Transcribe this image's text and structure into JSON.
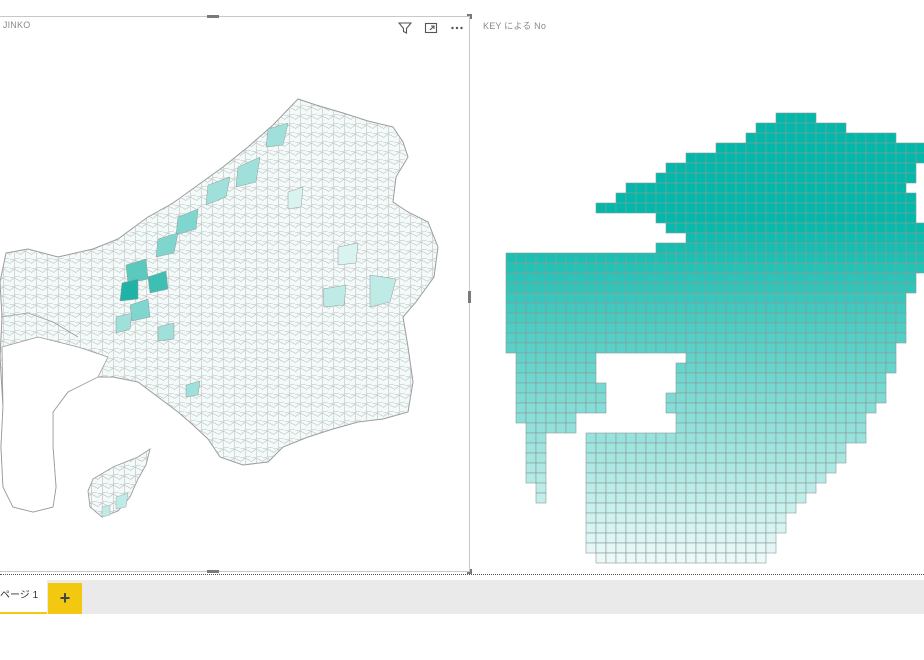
{
  "visuals": [
    {
      "title": "S JINKO",
      "type": "filled-map",
      "header_icons": [
        "filter-icon",
        "focus-mode-icon",
        "more-options-icon"
      ]
    },
    {
      "title": "KEY による No",
      "type": "grid-map"
    }
  ],
  "colors": {
    "accent": "#01b8aa",
    "light": "#e8f7f6",
    "border": "#9a9a9a",
    "tab_accent": "#f2c811"
  },
  "page_tabs": [
    {
      "label": "ページ 1",
      "active": true
    }
  ],
  "add_page_label": "+"
}
